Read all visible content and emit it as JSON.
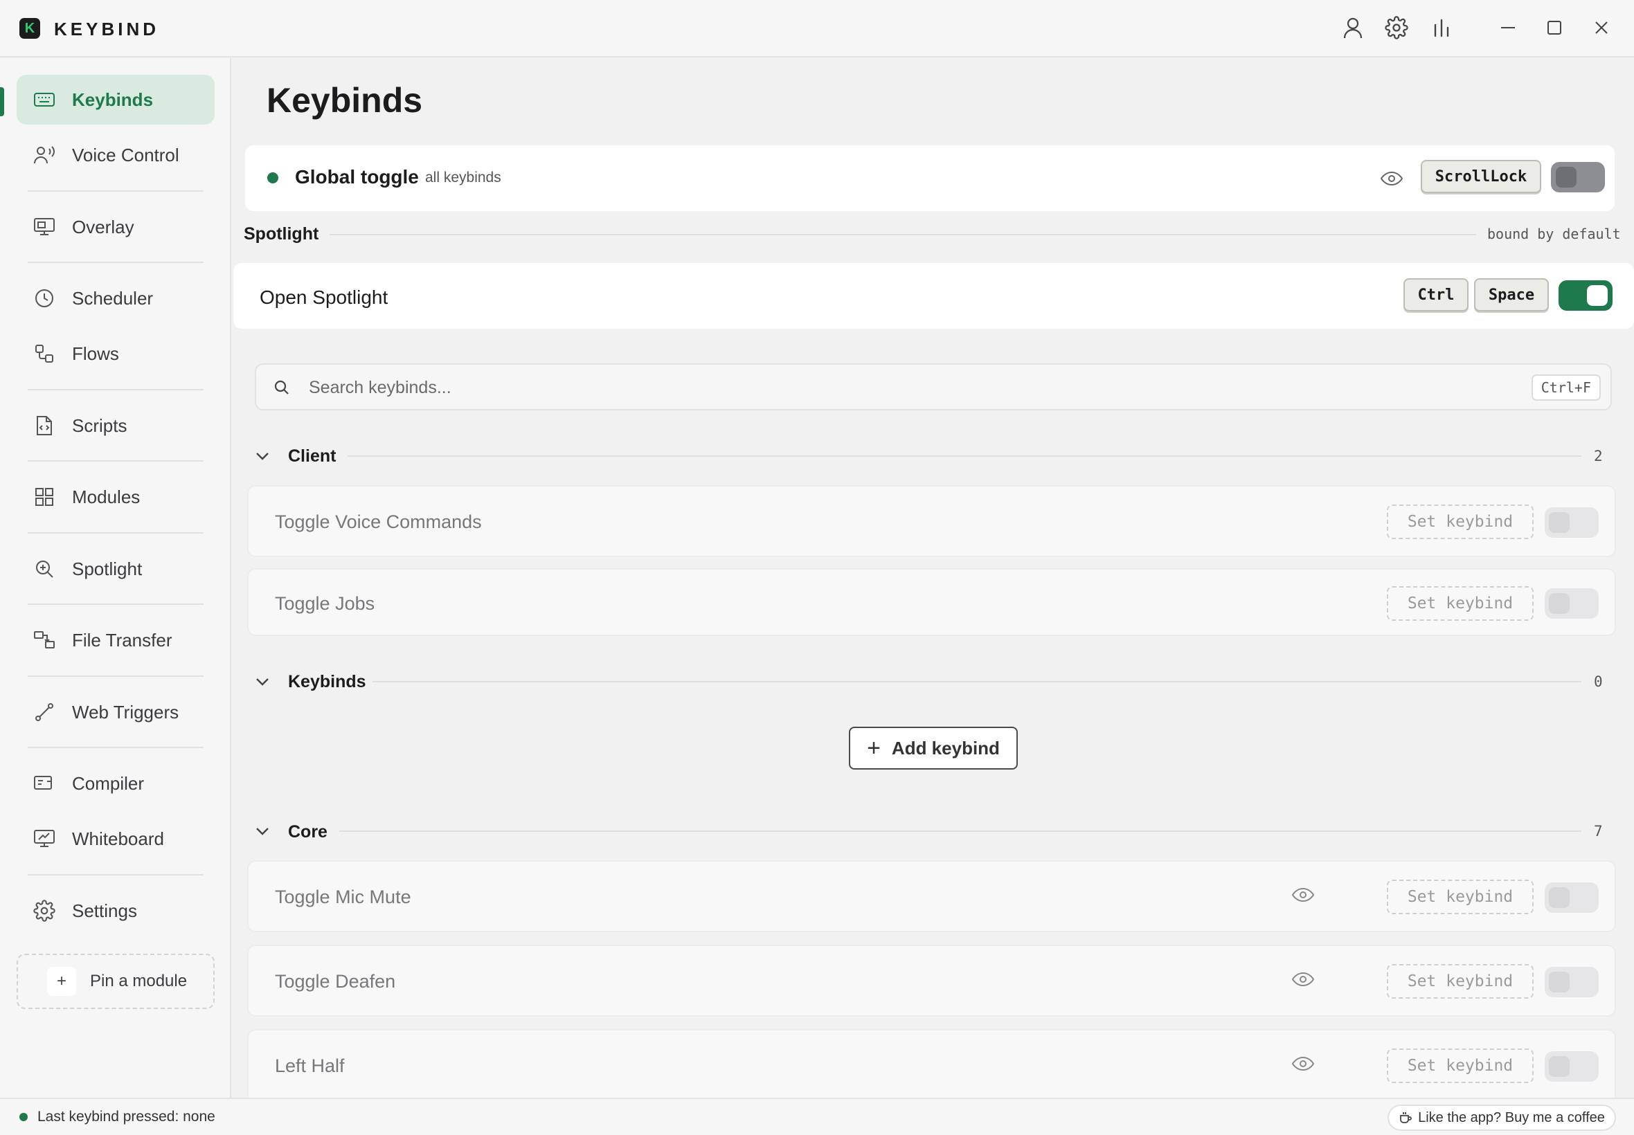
{
  "app": {
    "brand": "KEYBIND",
    "logo_letter": "K"
  },
  "titlebar": {
    "icons": [
      "user-icon",
      "gear-icon",
      "bar-chart-icon",
      "minimize-icon",
      "maximize-icon",
      "close-icon"
    ]
  },
  "sidebar": {
    "items": [
      {
        "label": "Keybinds",
        "icon": "keyboard-icon",
        "active": true
      },
      {
        "label": "Voice Control",
        "icon": "voice-user-icon"
      },
      {
        "label": "Overlay",
        "icon": "monitor-icon"
      },
      {
        "label": "Scheduler",
        "icon": "clock-icon"
      },
      {
        "label": "Flows",
        "icon": "flow-icon"
      },
      {
        "label": "Scripts",
        "icon": "script-file-icon"
      },
      {
        "label": "Modules",
        "icon": "grid-icon"
      },
      {
        "label": "Spotlight",
        "icon": "magnify-icon"
      },
      {
        "label": "File Transfer",
        "icon": "transfer-icon"
      },
      {
        "label": "Web Triggers",
        "icon": "link-nodes-icon"
      },
      {
        "label": "Compiler",
        "icon": "compiler-icon"
      },
      {
        "label": "Whiteboard",
        "icon": "whiteboard-icon"
      },
      {
        "label": "Settings",
        "icon": "gear-icon"
      }
    ],
    "pin_label": "Pin a module",
    "pin_plus": "+"
  },
  "main": {
    "title": "Keybinds",
    "global_toggle": {
      "title": "Global toggle",
      "subtitle": "all keybinds",
      "key": "ScrollLock",
      "enabled": false
    },
    "spotlight_section": {
      "label": "Spotlight",
      "note": "bound by default",
      "row": {
        "name": "Open Spotlight",
        "keys": [
          "Ctrl",
          "Space"
        ],
        "enabled": true
      }
    },
    "search": {
      "placeholder": "Search keybinds...",
      "shortcut": "Ctrl+F"
    },
    "set_keybind_label": "Set keybind",
    "add_keybind_label": "Add keybind",
    "groups": [
      {
        "label": "Client",
        "count": "2",
        "rows": [
          {
            "name": "Toggle Voice Commands",
            "visibility_icon": false
          },
          {
            "name": "Toggle Jobs",
            "visibility_icon": false
          }
        ]
      },
      {
        "label": "Keybinds",
        "count": "0",
        "rows": []
      },
      {
        "label": "Core",
        "count": "7",
        "rows": [
          {
            "name": "Toggle Mic Mute",
            "visibility_icon": true
          },
          {
            "name": "Toggle Deafen",
            "visibility_icon": true
          },
          {
            "name": "Left Half",
            "visibility_icon": true
          }
        ]
      }
    ]
  },
  "statusbar": {
    "last_pressed": "Last keybind pressed: none",
    "coffee": "Like the app? Buy me a coffee"
  },
  "colors": {
    "accent": "#1e7a4c",
    "active_bg": "#d9ebe1",
    "background": "#f1f1f2"
  }
}
